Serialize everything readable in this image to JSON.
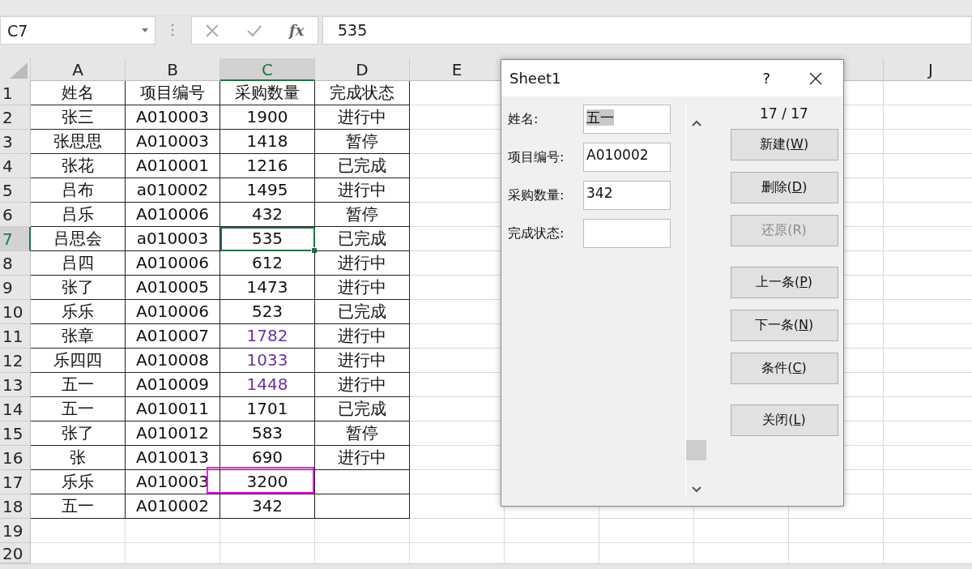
{
  "formula_bar": {
    "name_box": "C7",
    "function_label": "fx",
    "formula": "535"
  },
  "columns": [
    {
      "label": "A",
      "selected": false
    },
    {
      "label": "B",
      "selected": false
    },
    {
      "label": "C",
      "selected": true
    },
    {
      "label": "D",
      "selected": false
    },
    {
      "label": "E",
      "selected": false
    },
    {
      "label": "J",
      "selected": false
    }
  ],
  "rows": [
    {
      "number": "1",
      "selected": false,
      "cells": [
        "姓名",
        "项目编号",
        "采购数量",
        "完成状态"
      ]
    },
    {
      "number": "2",
      "selected": false,
      "cells": [
        "张三",
        "A010003",
        "1900",
        "进行中"
      ]
    },
    {
      "number": "3",
      "selected": false,
      "cells": [
        "张思思",
        "A010003",
        "1418",
        "暂停"
      ]
    },
    {
      "number": "4",
      "selected": false,
      "cells": [
        "张花",
        "A010001",
        "1216",
        "已完成"
      ]
    },
    {
      "number": "5",
      "selected": false,
      "cells": [
        "吕布",
        "a010002",
        "1495",
        "进行中"
      ]
    },
    {
      "number": "6",
      "selected": false,
      "cells": [
        "吕乐",
        "A010006",
        "432",
        "暂停"
      ]
    },
    {
      "number": "7",
      "selected": true,
      "cells": [
        "吕思会",
        "a010003",
        "535",
        "已完成"
      ]
    },
    {
      "number": "8",
      "selected": false,
      "cells": [
        "吕四",
        "A010006",
        "612",
        "进行中"
      ]
    },
    {
      "number": "9",
      "selected": false,
      "cells": [
        "张了",
        "A010005",
        "1473",
        "进行中"
      ]
    },
    {
      "number": "10",
      "selected": false,
      "cells": [
        "乐乐",
        "A010006",
        "523",
        "已完成"
      ]
    },
    {
      "number": "11",
      "selected": false,
      "color": "#7030a0",
      "cells": [
        "张章",
        "A010007",
        "1782",
        "进行中"
      ]
    },
    {
      "number": "12",
      "selected": false,
      "color": "#7030a0",
      "cells": [
        "乐四四",
        "A010008",
        "1033",
        "进行中"
      ]
    },
    {
      "number": "13",
      "selected": false,
      "color": "#7030a0",
      "cells": [
        "五一",
        "A010009",
        "1448",
        "进行中"
      ]
    },
    {
      "number": "14",
      "selected": false,
      "cells": [
        "五一",
        "A010011",
        "1701",
        "已完成"
      ]
    },
    {
      "number": "15",
      "selected": false,
      "cells": [
        "张了",
        "A010012",
        "583",
        "暂停"
      ]
    },
    {
      "number": "16",
      "selected": false,
      "cells": [
        "张",
        "A010013",
        "690",
        "进行中"
      ]
    },
    {
      "number": "17",
      "selected": false,
      "marked": true,
      "cells": [
        "乐乐",
        "A010003",
        "3200",
        ""
      ]
    },
    {
      "number": "18",
      "selected": false,
      "cells": [
        "五一",
        "A010002",
        "342",
        ""
      ]
    },
    {
      "number": "19",
      "selected": false,
      "cells": []
    },
    {
      "number": "20",
      "selected": false,
      "cells": []
    }
  ],
  "dialog": {
    "title": "Sheet1",
    "help": "?",
    "counter": "17 / 17",
    "fields": [
      {
        "label": "姓名:",
        "value": "五一",
        "text_selected": true
      },
      {
        "label": "项目编号:",
        "value": "A010002"
      },
      {
        "label": "采购数量:",
        "value": "342"
      },
      {
        "label": "完成状态:"
      }
    ],
    "button_groups": [
      [
        {
          "before": "新建(",
          "mnemonic": "W",
          "after": ")",
          "disabled": false
        },
        {
          "before": "删除(",
          "mnemonic": "D",
          "after": ")",
          "disabled": false
        },
        {
          "before": "还原(R)",
          "disabled": true
        }
      ],
      [
        {
          "before": "上一条(",
          "mnemonic": "P",
          "after": ")",
          "disabled": false
        },
        {
          "before": "下一条(",
          "mnemonic": "N",
          "after": ")",
          "disabled": false
        },
        {
          "before": "条件(",
          "mnemonic": "C",
          "after": ")",
          "disabled": false
        }
      ],
      [
        {
          "before": "关闭(",
          "mnemonic": "L",
          "after": ")",
          "disabled": false
        }
      ]
    ]
  }
}
